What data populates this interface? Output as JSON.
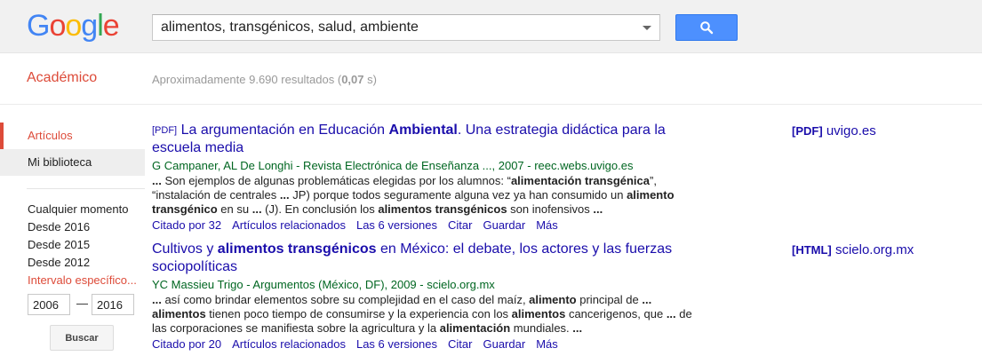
{
  "header": {
    "logo": "Google",
    "logo_colors": [
      "#4285f4",
      "#ea4335",
      "#fbbc05",
      "#4285f4",
      "#34a853",
      "#ea4335"
    ],
    "search_value": "alimentos, transgénicos, salud, ambiente"
  },
  "subheader": {
    "section": "Académico",
    "stats_prefix": "Aproximadamente 9.690 resultados (",
    "stats_time": "0,07",
    "stats_suffix": " s)"
  },
  "sidebar": {
    "nav": [
      "Artículos",
      "Mi biblioteca"
    ],
    "dates": [
      "Cualquier momento",
      "Desde 2016",
      "Desde 2015",
      "Desde 2012",
      "Intervalo específico..."
    ],
    "year_from": "2006",
    "year_to": "2016",
    "dash": "—",
    "search_button": "Buscar"
  },
  "results": [
    {
      "tag": "[PDF]",
      "title_parts": [
        {
          "text": "La argumentación en Educación ",
          "bold": false
        },
        {
          "text": "Ambiental",
          "bold": true
        },
        {
          "text": ". Una estrategia didáctica para la escuela media",
          "bold": false
        }
      ],
      "meta": "G Campaner, AL De Longhi - Revista Electrónica de Enseñanza ..., 2007 - reec.webs.uvigo.es",
      "snippet_parts": [
        {
          "text": "... ",
          "bold": true
        },
        {
          "text": "Son ejemplos de algunas problemáticas elegidas por los alumnos: “",
          "bold": false
        },
        {
          "text": "alimentación transgénica",
          "bold": true
        },
        {
          "text": "”, “instalación de centrales ",
          "bold": false
        },
        {
          "text": "...",
          "bold": true
        },
        {
          "text": " JP) porque todos seguramente alguna vez ya han consumido un ",
          "bold": false
        },
        {
          "text": "alimento transgénico",
          "bold": true
        },
        {
          "text": " en su ",
          "bold": false
        },
        {
          "text": "...",
          "bold": true
        },
        {
          "text": " (J). En conclusión los ",
          "bold": false
        },
        {
          "text": "alimentos transgénicos",
          "bold": true
        },
        {
          "text": " son inofensivos ",
          "bold": false
        },
        {
          "text": "...",
          "bold": true
        }
      ],
      "actions": [
        "Citado por 32",
        "Artículos relacionados",
        "Las 6 versiones",
        "Citar",
        "Guardar",
        "Más"
      ],
      "side_tag": "[PDF]",
      "side_domain": "uvigo.es"
    },
    {
      "tag": "",
      "title_parts": [
        {
          "text": "Cultivos y ",
          "bold": false
        },
        {
          "text": "alimentos transgénicos",
          "bold": true
        },
        {
          "text": " en México: el debate, los actores y las fuerzas sociopolíticas",
          "bold": false
        }
      ],
      "meta": "YC Massieu Trigo - Argumentos (México, DF), 2009 - scielo.org.mx",
      "snippet_parts": [
        {
          "text": "...",
          "bold": true
        },
        {
          "text": " así como brindar elementos sobre su complejidad en el caso del maíz, ",
          "bold": false
        },
        {
          "text": "alimento",
          "bold": true
        },
        {
          "text": " principal de ",
          "bold": false
        },
        {
          "text": "...",
          "bold": true
        },
        {
          "text": " ",
          "bold": false
        },
        {
          "text": "alimentos",
          "bold": true
        },
        {
          "text": " tienen poco tiempo de consumirse y la experiencia con los ",
          "bold": false
        },
        {
          "text": "alimentos",
          "bold": true
        },
        {
          "text": " cancerigenos, que ",
          "bold": false
        },
        {
          "text": "...",
          "bold": true
        },
        {
          "text": " de las corporaciones se manifiesta sobre la agricultura y la ",
          "bold": false
        },
        {
          "text": "alimentación",
          "bold": true
        },
        {
          "text": " mundiales. ",
          "bold": false
        },
        {
          "text": "...",
          "bold": true
        }
      ],
      "actions": [
        "Citado por 20",
        "Artículos relacionados",
        "Las 6 versiones",
        "Citar",
        "Guardar",
        "Más"
      ],
      "side_tag": "[HTML]",
      "side_domain": "scielo.org.mx"
    }
  ]
}
